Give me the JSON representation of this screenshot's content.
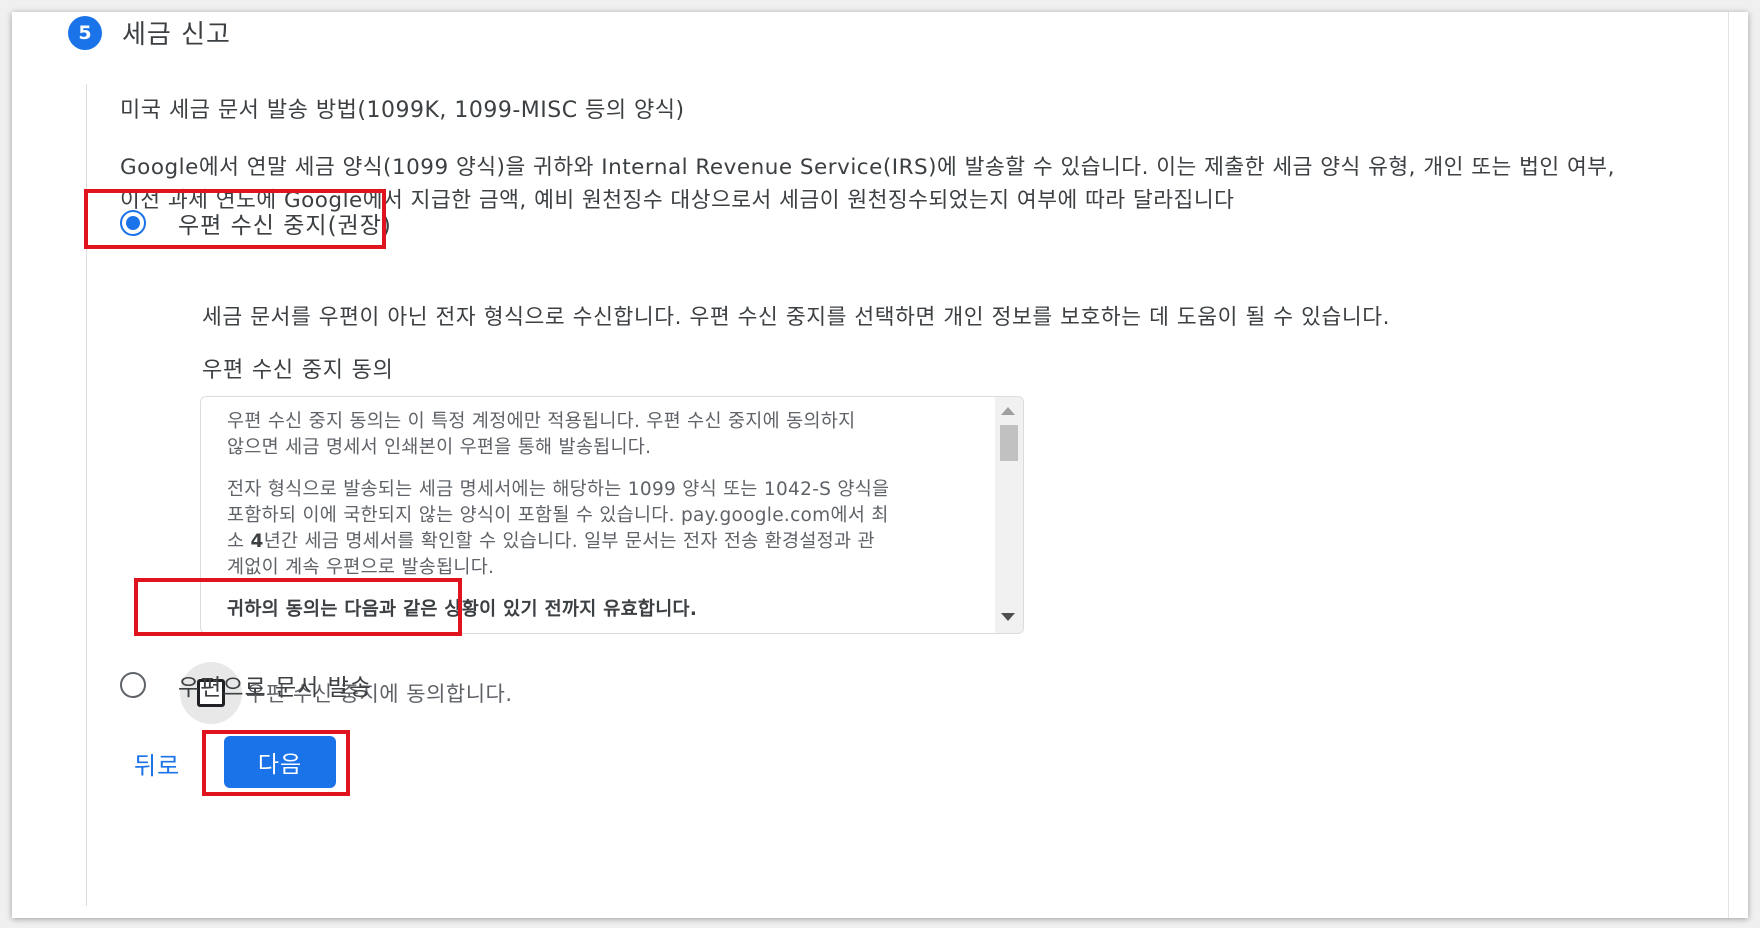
{
  "step": {
    "number": "5",
    "title": "세금 신고"
  },
  "section": {
    "title": "미국 세금 문서 발송 방법(1099K, 1099-MISC 등의 양식)",
    "desc_line1": "Google에서 연말 세금 양식(1099 양식)을 귀하와 Internal Revenue Service(IRS)에 발송할 수 있습니다. 이는 제출한 세금 양식 유형, 개인 또는 법인 여부,",
    "desc_line2": "이전 과세 연도에 Google에서 지급한 금액, 예비 원천징수 대상으로서 세금이 원천징수되었는지 여부에 따라 달라집니다"
  },
  "options": {
    "optout": {
      "label": "우편 수신 중지(권장)",
      "selected": true,
      "description": "세금 문서를 우편이 아닌 전자 형식으로 수신합니다. 우편 수신 중지를 선택하면 개인 정보를 보호하는 데 도움이 될 수 있습니다."
    },
    "mail": {
      "label": "우편으로 문서 발송",
      "selected": false
    }
  },
  "consent": {
    "title": "우편 수신 중지 동의",
    "p1_line1": "우편 수신 중지 동의는 이 특정 계정에만 적용됩니다.  우편 수신 중지에 동의하지",
    "p1_line2": "않으면 세금 명세서 인쇄본이 우편을 통해 발송됩니다.",
    "p2_line1": "전자 형식으로 발송되는 세금 명세서에는 해당하는 1099 양식 또는 1042-S 양식을",
    "p2_line2": "포함하되 이에 국한되지 않는 양식이 포함될 수 있습니다. pay.google.com에서 최",
    "p2_line3_pre": "소 ",
    "p2_line3_bold": "4",
    "p2_line3_post": "년간 세금 명세서를 확인할 수 있습니다. 일부 문서는 전자 전송 환경설정과 관",
    "p2_line4": "계없이 계속 우편으로 발송됩니다.",
    "p3_bold": "귀하의 동의는 다음과 같은 상황이 있기 전까지 유효합니다.",
    "checkbox_label": "우편 수신 중지에 동의합니다.",
    "checkbox_checked": false
  },
  "actions": {
    "back_label": "뒤로",
    "next_label": "다음"
  },
  "colors": {
    "accent": "#1a73e8",
    "highlight": "#e0141e"
  }
}
